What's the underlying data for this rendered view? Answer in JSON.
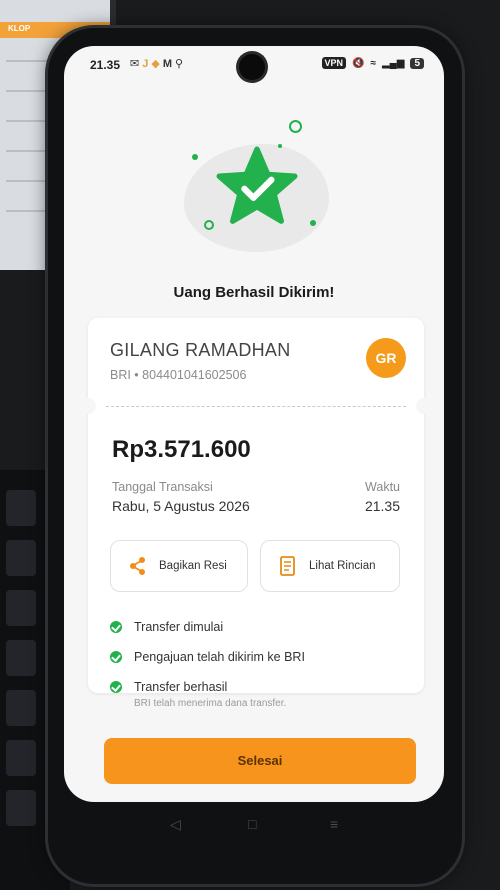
{
  "background": {
    "monitor_tab_label": "KLOP"
  },
  "status_bar": {
    "time": "21.35",
    "vpn": "VPN",
    "battery": "5"
  },
  "success": {
    "title": "Uang Berhasil Dikirim!",
    "icon": "star-check-icon",
    "accent_color": "#22b14c"
  },
  "recipient": {
    "name": "GILANG RAMADHAN",
    "account": "BRI • 804401041602506",
    "initials": "GR",
    "avatar_color": "#f59a1a"
  },
  "transaction": {
    "amount": "Rp3.571.600",
    "date_label": "Tanggal Transaksi",
    "date_value": "Rabu, 5 Agustus 2026",
    "time_label": "Waktu",
    "time_value": "21.35"
  },
  "actions": {
    "share_label": "Bagikan Resi",
    "detail_label": "Lihat Rincian"
  },
  "steps": [
    {
      "text": "Transfer dimulai",
      "sub": ""
    },
    {
      "text": "Pengajuan telah dikirim ke BRI",
      "sub": ""
    },
    {
      "text": "Transfer berhasil",
      "sub": "BRI telah menerima dana transfer."
    }
  ],
  "finish_button": {
    "label": "Selesai",
    "color": "#f7941d"
  }
}
